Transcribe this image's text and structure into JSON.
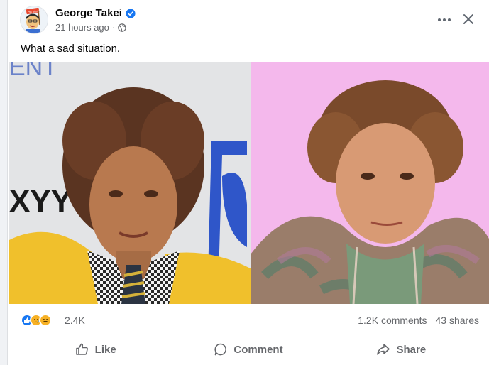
{
  "post": {
    "author": "George Takei",
    "timestamp": "21 hours ago",
    "separator": "·",
    "caption": "What a sad situation.",
    "avatar_badge": "Oh Myyy",
    "colors": {
      "verified": "#1877f2",
      "like": "#1877f2",
      "sad": "#f7b125",
      "haha": "#f7b125",
      "muted_text": "#65676b"
    },
    "icons": [
      "verified-icon",
      "globe-icon",
      "more-icon",
      "close-icon",
      "like-icon",
      "comment-icon",
      "share-icon"
    ]
  },
  "media": {
    "left_background_text": "ENT",
    "left_background_text_2": "XYY"
  },
  "engagement": {
    "reaction_count": "2.4K",
    "comments": "1.2K comments",
    "shares": "43 shares",
    "reactions": [
      "like",
      "sad",
      "haha"
    ]
  },
  "actions": {
    "like": "Like",
    "comment": "Comment",
    "share": "Share"
  }
}
